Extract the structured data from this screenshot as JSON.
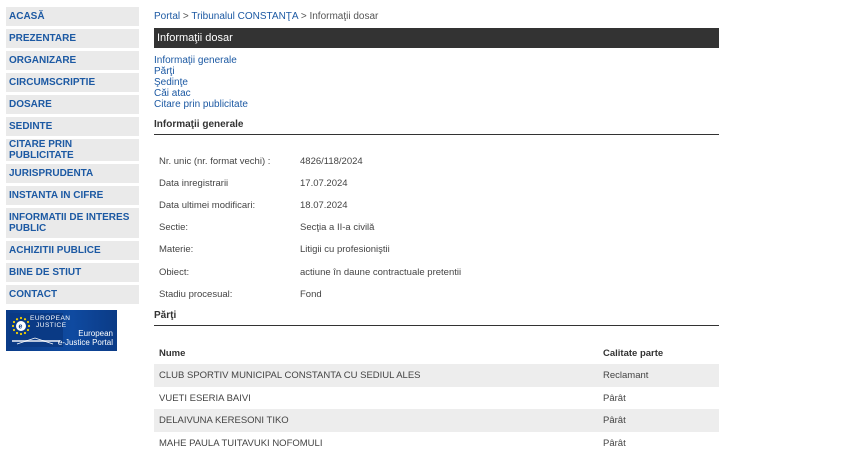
{
  "sidebar": {
    "items": [
      {
        "label": "ACASĂ"
      },
      {
        "label": "PREZENTARE"
      },
      {
        "label": "ORGANIZARE"
      },
      {
        "label": "CIRCUMSCRIPTIE"
      },
      {
        "label": "DOSARE"
      },
      {
        "label": "SEDINTE"
      },
      {
        "label": "CITARE PRIN PUBLICITATE"
      },
      {
        "label": "JURISPRUDENTA"
      },
      {
        "label": "INSTANTA IN CIFRE"
      },
      {
        "label": "INFORMATII DE INTERES PUBLIC"
      },
      {
        "label": "ACHIZITII PUBLICE"
      },
      {
        "label": "BINE DE STIUT"
      },
      {
        "label": "CONTACT"
      }
    ],
    "banner": {
      "logo_line1": "EUROPEAN",
      "logo_line2": "JUSTICE",
      "text_line1": "European",
      "text_line2": "e-Justice Portal"
    }
  },
  "breadcrumb": {
    "portal": "Portal",
    "tribunal": "Tribunalul CONSTANŢA",
    "current": "Informaţii dosar"
  },
  "title": "Informaţii dosar",
  "quick_links": [
    "Informaţii generale",
    "Părţi",
    "Şedinţe",
    "Căi atac",
    "Citare prin publicitate"
  ],
  "info_section": {
    "heading": "Informaţii generale",
    "rows": [
      {
        "label": "Nr. unic (nr. format vechi) :",
        "value": "4826/118/2024"
      },
      {
        "label": "Data inregistrarii",
        "value": "17.07.2024"
      },
      {
        "label": "Data ultimei modificari:",
        "value": "18.07.2024"
      },
      {
        "label": "Sectie:",
        "value": "Secţia a II-a civilă"
      },
      {
        "label": "Materie:",
        "value": "Litigii cu profesioniştii"
      },
      {
        "label": "Obiect:",
        "value": "actiune în daune contractuale pretentii"
      },
      {
        "label": "Stadiu procesual:",
        "value": "Fond"
      }
    ]
  },
  "parti_section": {
    "heading": "Părţi",
    "columns": [
      "Nume",
      "Calitate parte"
    ],
    "rows": [
      {
        "name": "CLUB SPORTIV MUNICIPAL CONSTANTA CU SEDIUL ALES",
        "role": "Reclamant"
      },
      {
        "name": "VUETI ESERIA BAIVI",
        "role": "Pârât"
      },
      {
        "name": "DELAIVUNA KERESONI TIKO",
        "role": "Pârât"
      },
      {
        "name": "MAHE PAULA TUITAVUKI NOFOMULI",
        "role": "Pârât"
      }
    ]
  },
  "colors": {
    "link": "#1c59a3",
    "nav_bg": "#eaeaea",
    "title_bar": "#333333",
    "row_alt": "#ededed"
  }
}
